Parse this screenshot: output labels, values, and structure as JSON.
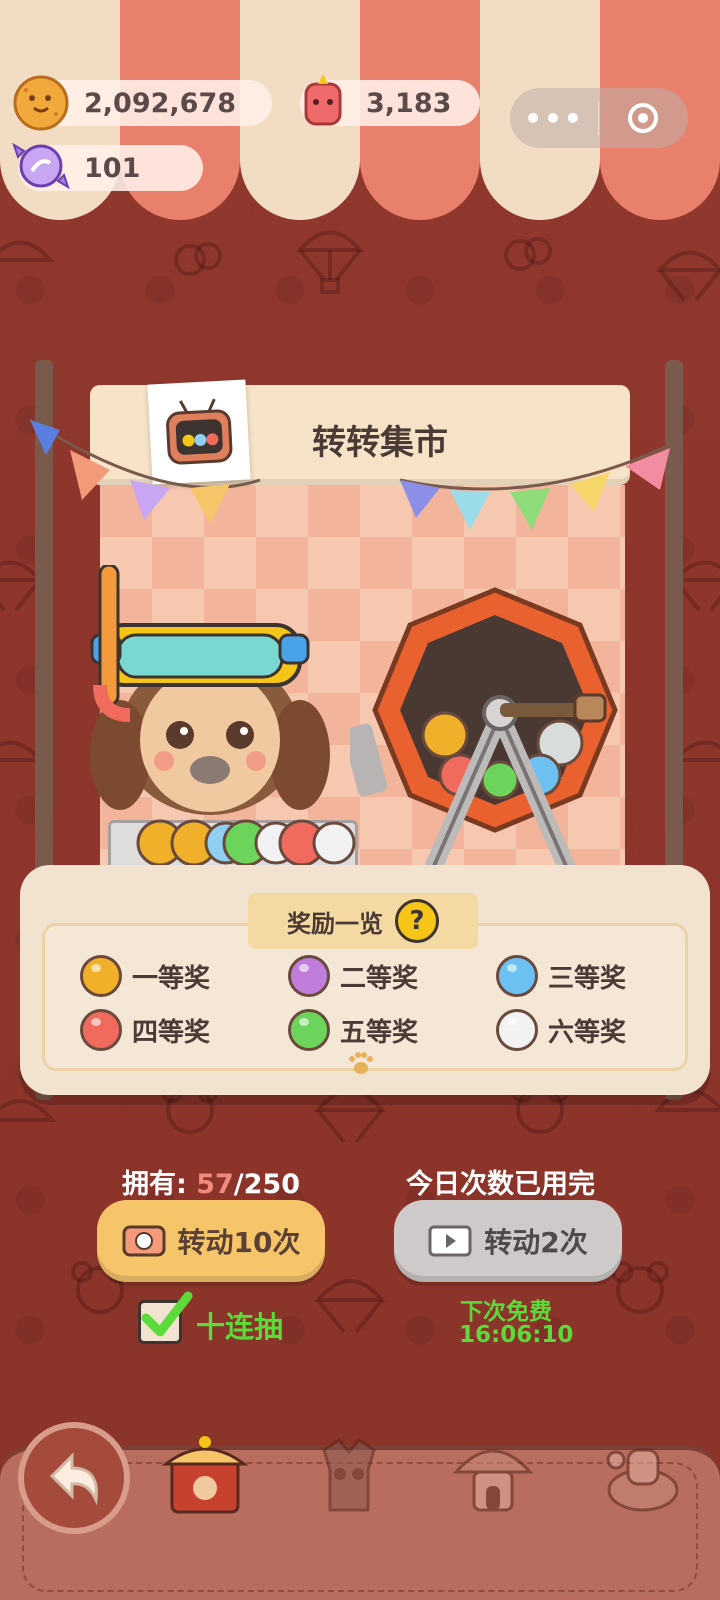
{
  "currencies": {
    "coins": "2,092,678",
    "gems": "3,183",
    "candy": "101"
  },
  "miniapp_menu": {
    "more_icon": "dots-icon",
    "close_icon": "target-icon"
  },
  "stall": {
    "title": "转转集市"
  },
  "rewards": {
    "title": "奖励一览",
    "help_icon": "?",
    "prizes": [
      {
        "label": "一等奖",
        "color": "#f0b02a"
      },
      {
        "label": "二等奖",
        "color": "#c07ddc"
      },
      {
        "label": "三等奖",
        "color": "#6cc1f2"
      },
      {
        "label": "四等奖",
        "color": "#f06a5e"
      },
      {
        "label": "五等奖",
        "color": "#6cd45a"
      },
      {
        "label": "六等奖",
        "color": "#f2f2f2"
      }
    ]
  },
  "owned": {
    "prefix": "拥有: ",
    "current": "57",
    "total": "/250"
  },
  "daily_status": "今日次数已用完",
  "spin10_button": "转动10次",
  "spin2_button": "转动2次",
  "ten_pull": {
    "label": "十连抽",
    "checked": true
  },
  "next_free": {
    "label": "下次免费",
    "time": "16:06:10"
  },
  "colors": {
    "background": "#8e3a30",
    "accent_green": "#5cda3a",
    "button_gold": "#f6c56a"
  }
}
